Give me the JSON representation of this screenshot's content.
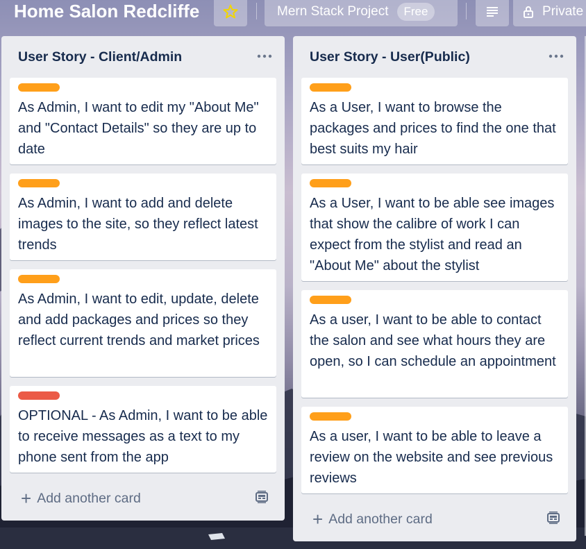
{
  "header": {
    "board_title": "Home Salon Redcliffe",
    "project_name": "Mern Stack Project",
    "plan_badge": "Free",
    "visibility_label": "Private"
  },
  "colors": {
    "label_orange": "#ff9f1a",
    "label_red": "#eb5a46",
    "list_bg": "#ebecf0",
    "card_text": "#172b4d",
    "muted_text": "#5e6c84",
    "star": "#f2d600"
  },
  "lists": [
    {
      "title": "User Story - Client/Admin",
      "add_card_label": "Add another card",
      "cards": [
        {
          "label_color": "orange",
          "text": "As Admin, I want to edit my \"About Me\" and \"Contact Details\" so they are up to date"
        },
        {
          "label_color": "orange",
          "text": "As Admin, I want to add and delete images to the site, so they reflect latest trends"
        },
        {
          "label_color": "orange",
          "text": "As Admin, I want to edit, update, delete and add packages and prices so they reflect current trends and market prices"
        },
        {
          "label_color": "red",
          "text": "OPTIONAL - As Admin, I want to be able to receive messages as a text to my phone sent from the app"
        }
      ]
    },
    {
      "title": "User Story - User(Public)",
      "add_card_label": "Add another card",
      "cards": [
        {
          "label_color": "orange",
          "text": "As a User, I want to browse the packages and prices to find the one that best suits my hair"
        },
        {
          "label_color": "orange",
          "text": "As a User, I want to be able see images that show the calibre of work I can expect from the stylist and read an \"About Me\" about the stylist"
        },
        {
          "label_color": "orange",
          "text": "As a user, I want to be able to contact the salon and see what hours they are open, so I can schedule an appointment"
        },
        {
          "label_color": "orange",
          "text": "As a user, I want to be able to leave a review on the website and see previous reviews"
        }
      ]
    }
  ],
  "icons": {
    "star": "star-icon",
    "menu": "menu-lines-icon",
    "lock": "lock-icon",
    "list_menu": "more-horizontal-icon",
    "add": "plus-icon",
    "template": "card-template-icon"
  }
}
